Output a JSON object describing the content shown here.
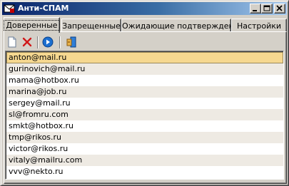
{
  "window": {
    "title": "Анти-СПАМ",
    "controls": {
      "minimize": "minimize",
      "maximize": "maximize",
      "close": "close"
    }
  },
  "tabs": [
    {
      "label": "Доверенные",
      "active": true
    },
    {
      "label": "Запрещенные",
      "active": false
    },
    {
      "label": "Ожидающие подтверждения",
      "active": false
    },
    {
      "label": "Настройки",
      "active": false
    }
  ],
  "toolbar": {
    "icons": [
      "new-document-icon",
      "delete-icon",
      "go-icon",
      "exit-icon"
    ]
  },
  "emails": [
    "anton@mail.ru",
    "gurinovich@mail.ru",
    "mama@hotbox.ru",
    "marina@job.ru",
    "sergey@mail.ru",
    "sl@fromru.com",
    "smkt@hotbox.ru",
    "tmp@rikos.ru",
    "victor@rikos.ru",
    "vitaly@mailru.com",
    "vvv@nekto.ru"
  ],
  "selected_index": 0,
  "colors": {
    "title_start": "#0a246a",
    "title_end": "#a6caf0",
    "selected_row": "#f6d890",
    "alt_row": "#eeeae3",
    "face": "#d4d0c8"
  }
}
